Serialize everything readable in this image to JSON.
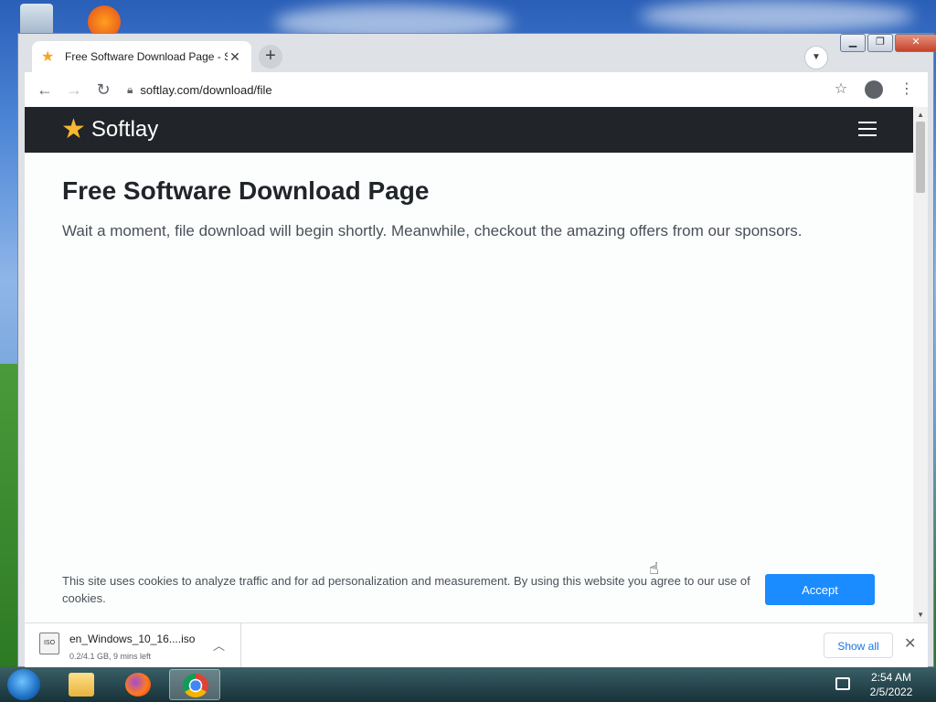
{
  "browser": {
    "tab_title": "Free Software Download Page - Softlay",
    "tab_close_glyph": "✕",
    "new_tab_glyph": "+",
    "url": "softlay.com/download/file",
    "window_controls": {
      "minimize": "▁",
      "restore": "❐",
      "close": "✕"
    }
  },
  "site": {
    "brand": "Softlay",
    "heading": "Free Software Download Page",
    "lead": "Wait a moment, file download will begin shortly. Meanwhile, checkout the amazing offers from our sponsors."
  },
  "cookie": {
    "text": "This site uses cookies to analyze traffic and for ad personalization and measurement. By using this website you agree to our use of cookies.",
    "accept_label": "Accept"
  },
  "download": {
    "file_name": "en_Windows_10_16....iso",
    "status": "0.2/4.1 GB, 9 mins left",
    "icon_label": "ISO",
    "progress_fraction": 0.05,
    "show_all_label": "Show all"
  },
  "taskbar": {
    "time": "2:54 AM",
    "date": "2/5/2022",
    "apps": [
      "file-explorer",
      "firefox",
      "chrome"
    ]
  },
  "colors": {
    "accept_blue": "#1a8cff",
    "site_header": "#212529",
    "star": "#f7b731"
  }
}
